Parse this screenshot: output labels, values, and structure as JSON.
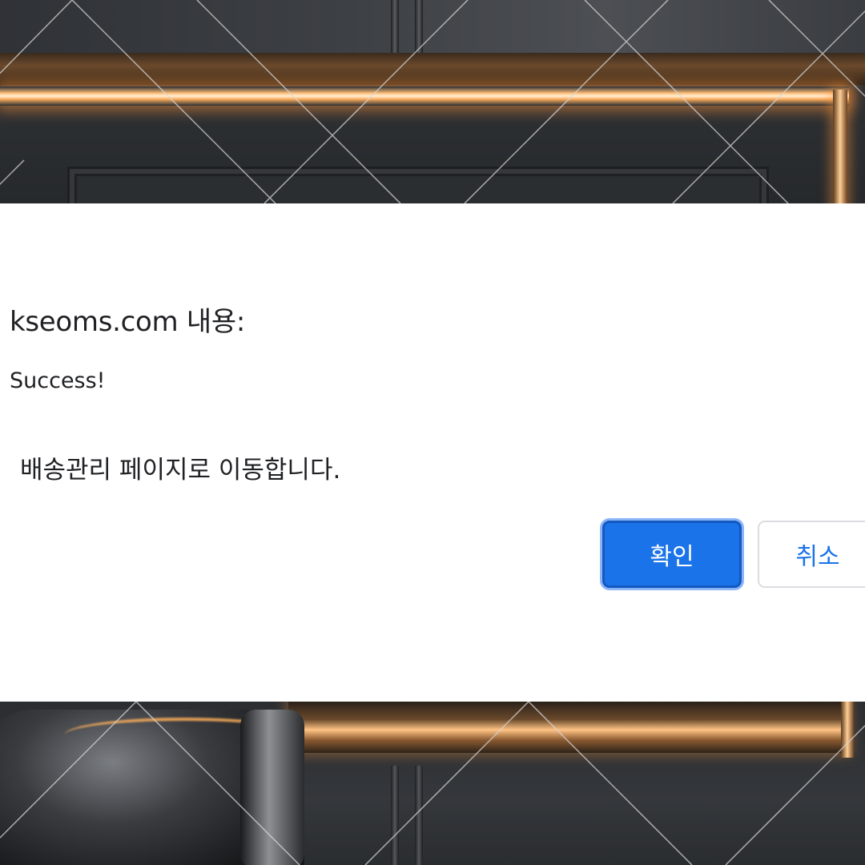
{
  "dialog": {
    "title": "kseoms.com 내용:",
    "line1": "Success!",
    "line2": "배송관리 페이지로 이동합니다.",
    "ok_label": "확인",
    "cancel_label": "취소"
  },
  "colors": {
    "primary": "#1a73e8",
    "dialog_background": "#ffffff",
    "text": "#202124",
    "backdrop_glow": "#ffbf7a",
    "backdrop_wall": "#2f3236"
  }
}
